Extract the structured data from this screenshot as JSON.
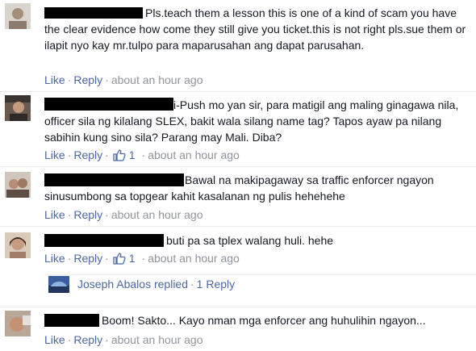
{
  "comments": [
    {
      "text": "Pls.teach them a lesson this is one of a kind of scam you have the clear evidence how come they still give you ticket.this is not right pls.sue them or ilapit nyo kay mr.tulpo para maparusahan ang dapat parusahan.",
      "like_label": "Like",
      "reply_label": "Reply",
      "time": "about an hour ago"
    },
    {
      "text": "i-Push mo yan sir, para matigil ang maling ginagawa nila, officer sila ng kilalang SLEX, bakit wala silang name tag? Tapos ayaw pa nilang sabihin kung sino sila? Parang may Mali. Diba?",
      "like_label": "Like",
      "reply_label": "Reply",
      "like_count": "1",
      "time": "about an hour ago"
    },
    {
      "text": "Bawal na makipagaway sa traffic enforcer ngayon sinusumbong sa topgear kahit kasalanan ng pulis hehehehe",
      "like_label": "Like",
      "reply_label": "Reply",
      "time": "about an hour ago"
    },
    {
      "text": "buti pa sa tplex walang huli. hehe",
      "like_label": "Like",
      "reply_label": "Reply",
      "like_count": "1",
      "time": "about an hour ago",
      "replies": {
        "author": "Joseph Abalos",
        "verb": "replied",
        "count_label": "1 Reply"
      }
    },
    {
      "text": "Boom! Sakto... Kayo nman mga enforcer ang huhulihin ngayon...",
      "like_label": "Like",
      "reply_label": "Reply",
      "time": "about an hour ago"
    }
  ],
  "colors": {
    "link": "#4b67a8",
    "meta": "#90949c",
    "text": "#141823",
    "divider": "#e9ebee",
    "redaction": "#000000"
  },
  "icons": {
    "like": "thumbs-up-icon"
  }
}
